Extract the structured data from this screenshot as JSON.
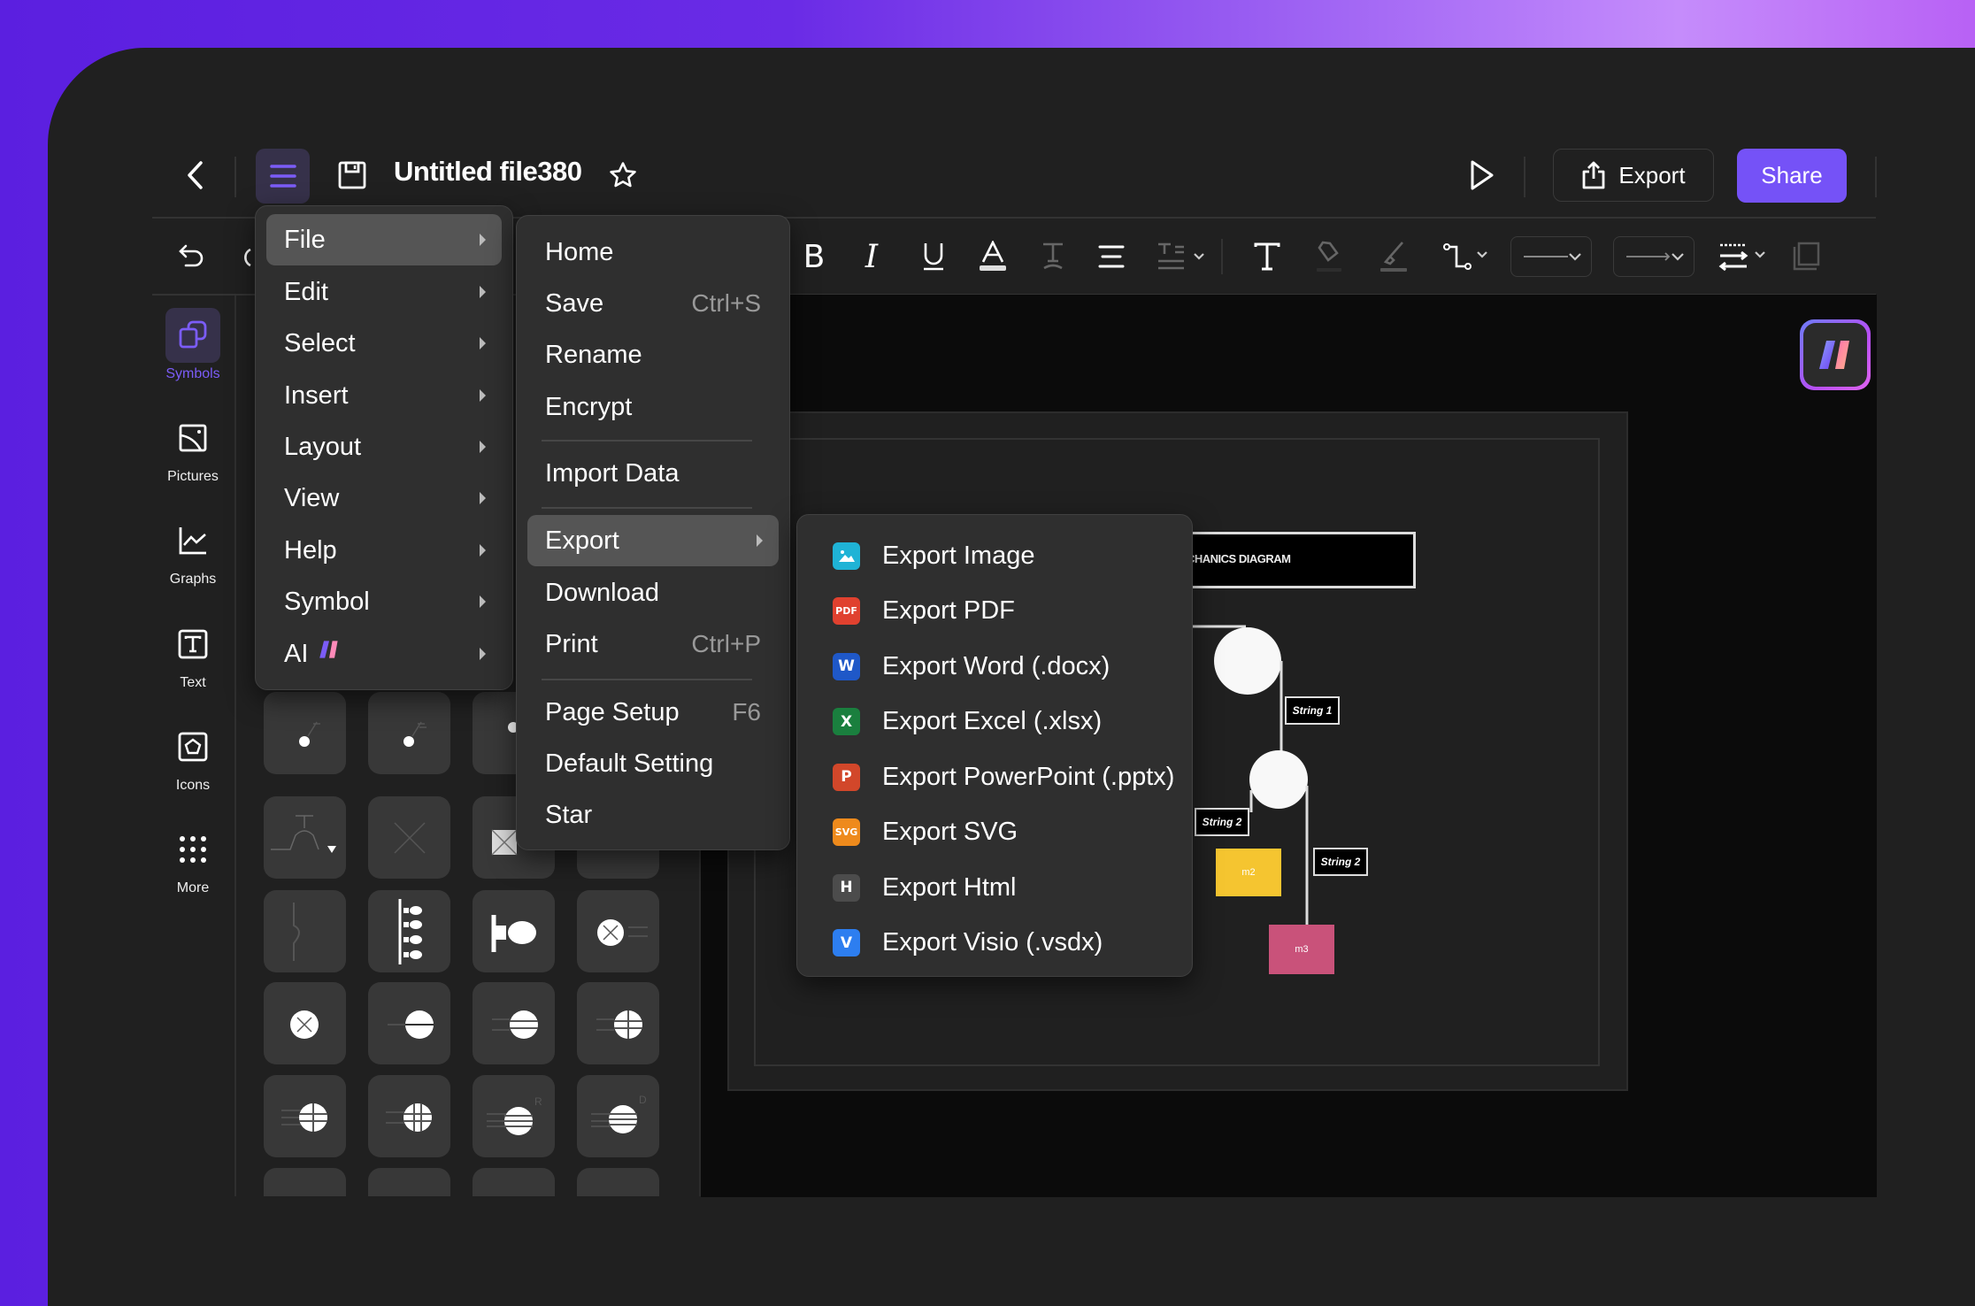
{
  "header": {
    "title": "Untitled file380",
    "export_label": "Export",
    "share_label": "Share",
    "icons": [
      "back-icon",
      "menu-icon",
      "save-icon",
      "star-icon",
      "play-icon",
      "export-icon"
    ]
  },
  "toolbar": {
    "icons": [
      "undo-icon",
      "redo-icon",
      "bold-icon",
      "italic-icon",
      "underline-icon",
      "font-color-icon",
      "text-style-icon",
      "align-icon",
      "text-spacing-icon",
      "text-icon",
      "fill-icon",
      "line-color-icon",
      "connector-icon",
      "line-style-dropdown",
      "arrow-style-dropdown",
      "line-spacing-icon",
      "frame-icon"
    ]
  },
  "rail": {
    "items": [
      {
        "label": "Symbols",
        "icon": "symbols-icon",
        "active": true
      },
      {
        "label": "Pictures",
        "icon": "pictures-icon"
      },
      {
        "label": "Graphs",
        "icon": "graphs-icon"
      },
      {
        "label": "Text",
        "icon": "text-icon"
      },
      {
        "label": "Icons",
        "icon": "icons-icon"
      },
      {
        "label": "More",
        "icon": "more-icon"
      }
    ]
  },
  "main_menu": {
    "items": [
      {
        "label": "File",
        "active": true
      },
      {
        "label": "Edit"
      },
      {
        "label": "Select"
      },
      {
        "label": "Insert"
      },
      {
        "label": "Layout"
      },
      {
        "label": "View"
      },
      {
        "label": "Help"
      },
      {
        "label": "Symbol"
      },
      {
        "label": "AI"
      }
    ]
  },
  "file_menu": {
    "items": [
      {
        "label": "Home"
      },
      {
        "label": "Save",
        "shortcut": "Ctrl+S"
      },
      {
        "label": "Rename"
      },
      {
        "label": "Encrypt"
      },
      {
        "label": "Import Data"
      },
      {
        "label": "Export",
        "active": true
      },
      {
        "label": "Download"
      },
      {
        "label": "Print",
        "shortcut": "Ctrl+P"
      },
      {
        "label": "Page Setup",
        "shortcut": "F6"
      },
      {
        "label": "Default Setting"
      },
      {
        "label": "Star"
      }
    ]
  },
  "export_menu": {
    "items": [
      {
        "label": "Export Image",
        "badge": "",
        "color": "#1fb3d6"
      },
      {
        "label": "Export PDF",
        "badge": "PDF",
        "color": "#e0412f"
      },
      {
        "label": "Export Word (.docx)",
        "badge": "W",
        "color": "#1f58c8"
      },
      {
        "label": "Export Excel (.xlsx)",
        "badge": "X",
        "color": "#1a7f3e"
      },
      {
        "label": "Export PowerPoint (.pptx)",
        "badge": "P",
        "color": "#d2472a"
      },
      {
        "label": "Export SVG",
        "badge": "SVG",
        "color": "#ee8a1c"
      },
      {
        "label": "Export Html",
        "badge": "H",
        "color": "#4c4c4c"
      },
      {
        "label": "Export Visio (.vsdx)",
        "badge": "V",
        "color": "#2d7ef0"
      }
    ]
  },
  "diagram": {
    "title": "CHANICS DIAGRAM",
    "labels": [
      "String 1",
      "String 2",
      "String 2"
    ],
    "masses": [
      {
        "label": "m2",
        "color": "#f5c530"
      },
      {
        "label": "m3",
        "color": "#c9527a"
      }
    ]
  },
  "colors": {
    "accent": "#7552f7",
    "menu_bg": "#2f2f2f",
    "app_bg": "#202020"
  }
}
